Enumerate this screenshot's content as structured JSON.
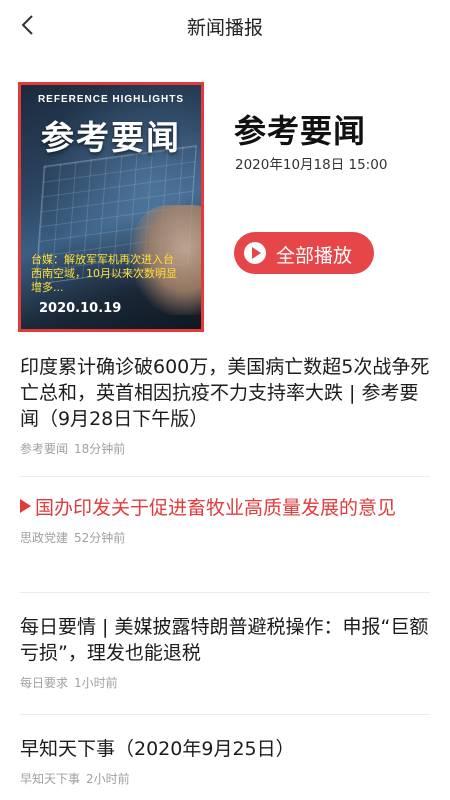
{
  "header": {
    "title": "新闻播报"
  },
  "cover": {
    "overline": "REFERENCE HIGHLIGHTS",
    "title": "参考要闻",
    "teaser": "台媒：解放军军机再次进入台西南空域，10月以来次数明显增多...",
    "date": "2020.10.19"
  },
  "program": {
    "title": "参考要闻",
    "datetime": "2020年10月18日  15:00",
    "play_label": "全部播放"
  },
  "news": [
    {
      "headline": "印度累计确诊破600万，美国病亡数超5次战争死亡总和，英首相因抗疫不力支持率大跌 | 参考要闻（9月28日下午版）",
      "source": "参考要闻",
      "time": "18分钟前"
    },
    {
      "headline": "国办印发关于促进畜牧业高质量发展的意见",
      "source": "思政党建",
      "time": "52分钟前",
      "playing": true
    },
    {
      "headline": "每日要情 | 美媒披露特朗普避税操作：申报“巨额亏损”，理发也能退税",
      "source": "每日要求",
      "time": "1小时前"
    },
    {
      "headline": "早知天下事（2020年9月25日）",
      "source": "早知天下事",
      "time": "2小时前"
    }
  ],
  "colors": {
    "accent": "#e74649",
    "meta": "#a0a0a0"
  }
}
